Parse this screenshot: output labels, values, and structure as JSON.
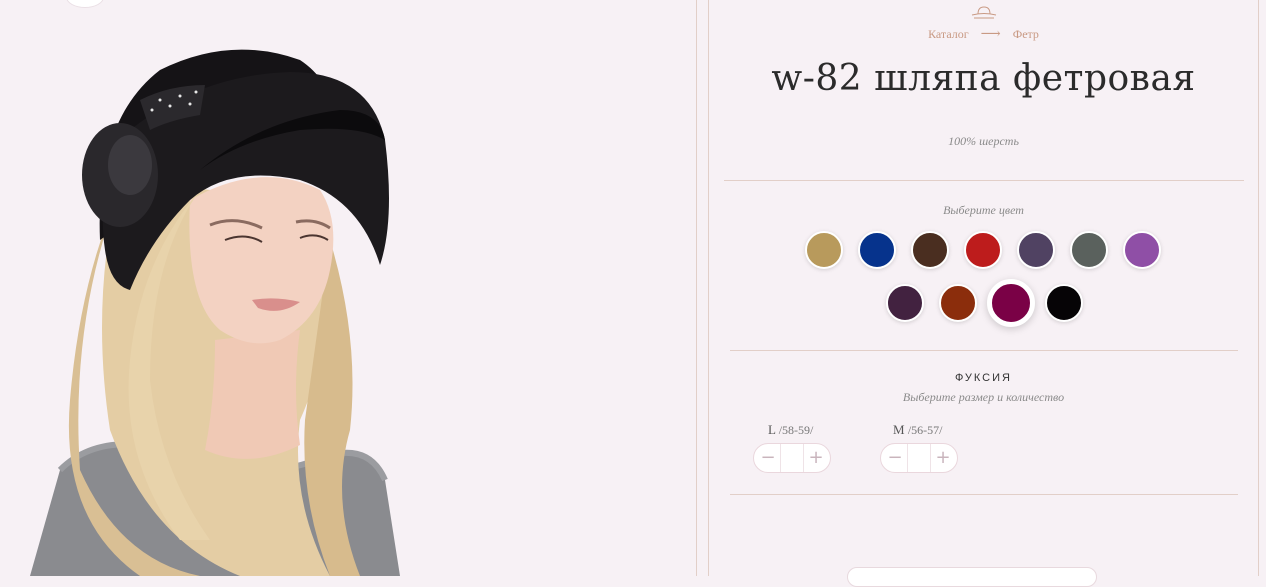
{
  "breadcrumb": {
    "catalog": "Каталог",
    "arrow": "⟶",
    "category": "Фетр"
  },
  "product": {
    "title": "w-82 шляпа фетровая",
    "material": "100% шерсть"
  },
  "colors": {
    "prompt": "Выберите цвет",
    "swatches": [
      {
        "name": "beige",
        "hex": "#b89a5c"
      },
      {
        "name": "blue",
        "hex": "#06338c"
      },
      {
        "name": "brown",
        "hex": "#4a2e20"
      },
      {
        "name": "red",
        "hex": "#bd1c1c"
      },
      {
        "name": "purple-grey",
        "hex": "#504262"
      },
      {
        "name": "grey-green",
        "hex": "#5a615d"
      },
      {
        "name": "violet",
        "hex": "#8f4fa6"
      },
      {
        "name": "plum",
        "hex": "#422240"
      },
      {
        "name": "rust",
        "hex": "#8b2d0c"
      },
      {
        "name": "fuchsia",
        "hex": "#7a0146",
        "selected": true
      },
      {
        "name": "black",
        "hex": "#060406"
      }
    ],
    "selected_name": "ФУКСИЯ"
  },
  "sizes": {
    "prompt": "Выберите размер и количество",
    "items": [
      {
        "size": "L",
        "dims": "/58-59/"
      },
      {
        "size": "M",
        "dims": "/56-57/"
      }
    ],
    "minus_icon": "−",
    "plus_icon": "+"
  },
  "accent_color": "#c99a84",
  "background_color": "#f7f1f5"
}
